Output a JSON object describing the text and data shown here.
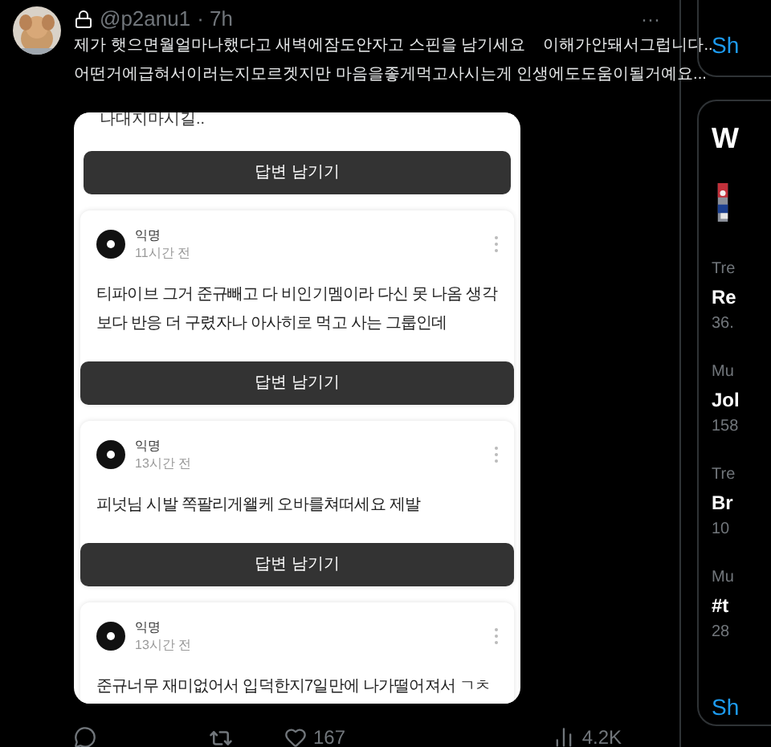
{
  "tweet": {
    "handle": "@p2anu1",
    "time": "· 7h",
    "more": "···",
    "text_lines": [
      "제가 햇으면월얼마나했다고 새벽에잠도안자고 스핀을 남기세요    이해가안돼서그럽니다..",
      "어떤거에급혀서이러는지모르겟지만 마음을좋게먹고사시는게 인생에도도움이될거예요..."
    ],
    "image": {
      "top_text": "나대지마시길..",
      "top_button": "답변 남기기",
      "questions": [
        {
          "author": "익명",
          "time": "11시간 전",
          "text": "티파이브 그거 준규빼고 다 비인기멤이라 다신 못 나옴 생각보다 반응 더 구렸자나 아사히로 먹고 사는 그룹인데",
          "button": "답변 남기기"
        },
        {
          "author": "익명",
          "time": "13시간 전",
          "text": "피넛님 시발 쪽팔리게왤케 오바를쳐떠세요 제발",
          "button": "답변 남기기"
        },
        {
          "author": "익명",
          "time": "13시간 전",
          "text": "준규너무 재미없어서 입덕한지7일만에 나가떨어져서 ㄱㅊ"
        }
      ]
    },
    "likes": "167",
    "views": "4.2K"
  },
  "sidebar": {
    "top_link": "Sh",
    "panel_title": "W",
    "trends": [
      {
        "category": "Tre",
        "name": "Re",
        "count": "36."
      },
      {
        "category": "Mu",
        "name": "Jol",
        "count": "158"
      },
      {
        "category": "Tre",
        "name": "Br",
        "count": "10"
      },
      {
        "category": "Mu",
        "name": "#t",
        "count": "28"
      }
    ],
    "show_more": "Sh"
  }
}
